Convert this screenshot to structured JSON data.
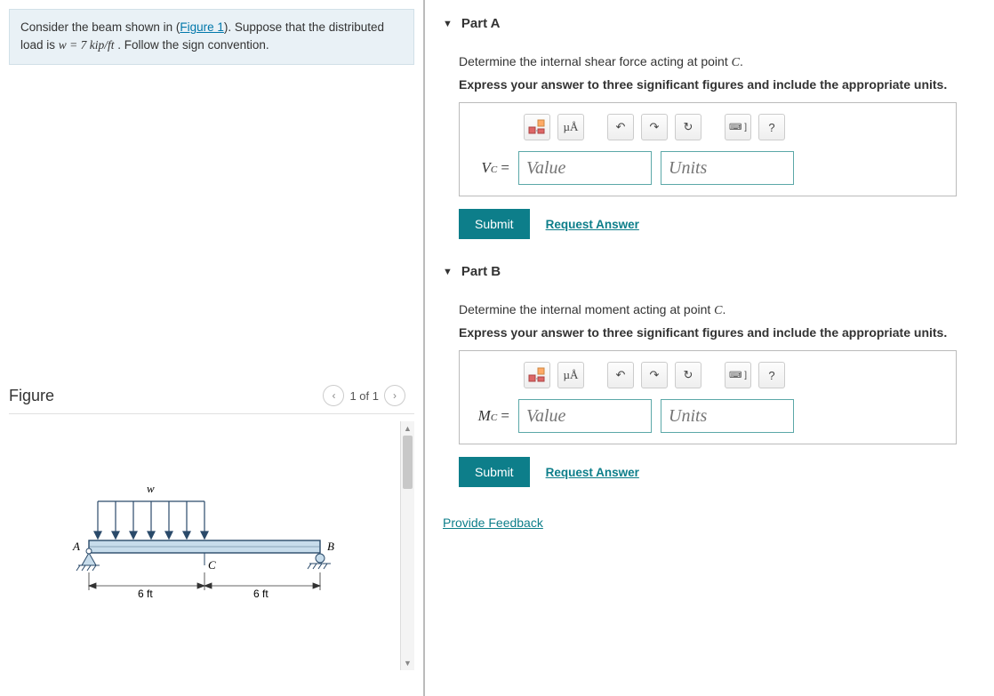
{
  "problem": {
    "text_before": "Consider the beam shown in (",
    "figure_link": "Figure 1",
    "text_mid": "). Suppose that the distributed load is ",
    "equation": "w = 7  kip/ft",
    "text_after": " . Follow the sign convention."
  },
  "figure": {
    "title": "Figure",
    "pager": "1 of 1",
    "labels": {
      "w": "w",
      "A": "A",
      "B": "B",
      "C": "C",
      "left_len": "6 ft",
      "right_len": "6 ft"
    }
  },
  "partA": {
    "title": "Part A",
    "prompt_text": "Determine the internal shear force acting at point ",
    "prompt_var": "C",
    "prompt_end": ".",
    "instruction": "Express your answer to three significant figures and include the appropriate units.",
    "var_label": "V",
    "var_sub": "C",
    "eq": " =",
    "value_placeholder": "Value",
    "units_placeholder": "Units",
    "submit": "Submit",
    "request": "Request Answer"
  },
  "partB": {
    "title": "Part B",
    "prompt_text": "Determine the internal moment acting at point ",
    "prompt_var": "C",
    "prompt_end": ".",
    "instruction": "Express your answer to three significant figures and include the appropriate units.",
    "var_label": "M",
    "var_sub": "C",
    "eq": " =",
    "value_placeholder": "Value",
    "units_placeholder": "Units",
    "submit": "Submit",
    "request": "Request Answer"
  },
  "toolbar": {
    "spec_label": "µÅ",
    "help_label": "?"
  },
  "feedback": "Provide Feedback"
}
